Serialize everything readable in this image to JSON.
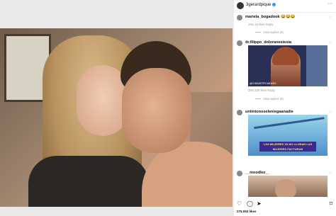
{
  "post": {
    "username": "3gerardpique",
    "more_icon": "more-icon"
  },
  "comments": [
    {
      "username": "mariela_bogadook",
      "text": "😂😂😂",
      "meta": "19m  48 likes  Reply",
      "replies": "View replies (6)"
    },
    {
      "username": "dr.filippo_doloranestesia",
      "text": "",
      "meta": "19m  225 likes  Reply",
      "replies": "View replies (5)",
      "thumb_caption": "@CHEMISTRY.MEMES"
    },
    {
      "username": "untintonoseleniegaanadie",
      "text": "",
      "meta": "",
      "replies": "",
      "thumb_caption": "LAS MUJERES YA NO LLORAN LAS MUJERES FACTURAN"
    },
    {
      "username": "__moodlez__",
      "text": "",
      "meta": "",
      "replies": ""
    }
  ],
  "actions": {
    "like": "♡",
    "comment": "◯",
    "share": "➤",
    "save": "⌑"
  },
  "likes": "275.052 likes"
}
